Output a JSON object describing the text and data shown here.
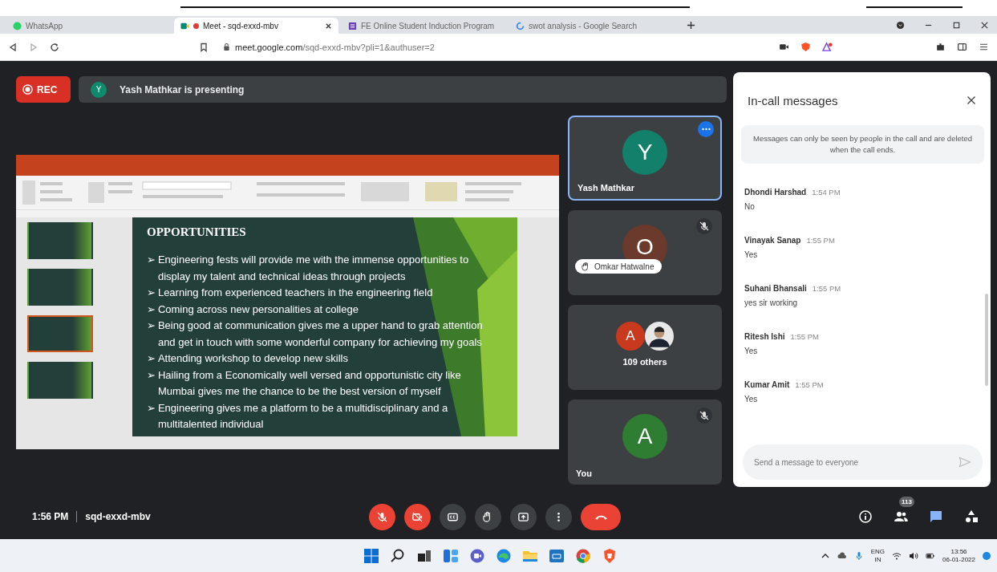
{
  "browser": {
    "tabs": [
      {
        "title": "WhatsApp",
        "kind": "whatsapp",
        "selected": false,
        "recording": false
      },
      {
        "title": "Meet - sqd-exxd-mbv",
        "kind": "meet",
        "selected": true,
        "recording": true
      },
      {
        "title": "FE Online Student Induction Program",
        "kind": "forms",
        "selected": false,
        "recording": false
      },
      {
        "title": "swot analysis - Google Search",
        "kind": "google",
        "selected": false,
        "recording": false
      }
    ],
    "url_host": "meet.google.com",
    "url_path": "/sqd-exxd-mbv?pli=1&authuser=2"
  },
  "meet": {
    "rec_label": "REC",
    "presenter": {
      "initial": "Y",
      "color": "#0f8a6c",
      "text": "Yash Mathkar is presenting"
    },
    "slide": {
      "title": "OPPORTUNITIES",
      "bullets": [
        "Engineering fests will provide me with the immense opportunities to display my talent and technical ideas through projects",
        "Learning from experienced teachers in the engineering field",
        "Coming across new personalities at college",
        "Being good at communication gives me a upper hand  to grab attention and get in touch with some wonderful company  for achieving my goals",
        "Attending workshop to develop new skills",
        " Hailing from a Economically well versed and opportunistic city like Mumbai gives me the chance to be the best version of myself",
        "Engineering gives me a platform to be a multidisciplinary and a multitalented individual"
      ],
      "bullet_mark": "➢",
      "thumbnails": [
        {
          "selected": false
        },
        {
          "selected": false
        },
        {
          "selected": true
        },
        {
          "selected": false
        }
      ]
    },
    "tiles": [
      {
        "kind": "person",
        "initial": "Y",
        "color": "#12806a",
        "name": "Yash Mathkar",
        "highlighted": true,
        "muted": false,
        "hand_raised": false
      },
      {
        "kind": "person",
        "initial": "O",
        "color": "#6b3a2c",
        "name": "Omkar Hatwalne",
        "highlighted": false,
        "muted": true,
        "hand_raised": true
      },
      {
        "kind": "group",
        "initial": "A",
        "color": "#c8391e",
        "name": "109 others",
        "highlighted": false,
        "muted": false
      },
      {
        "kind": "person",
        "initial": "A",
        "color": "#2e7d32",
        "name": "You",
        "highlighted": false,
        "muted": true,
        "hand_raised": false
      }
    ],
    "chat": {
      "title": "In-call messages",
      "notice": "Messages can only be seen by people in the call and are deleted when the call ends.",
      "messages": [
        {
          "name": "Dhondi Harshad",
          "time": "1:54 PM",
          "text": "No"
        },
        {
          "name": "Vinayak Sanap",
          "time": "1:55 PM",
          "text": "Yes"
        },
        {
          "name": "Suhani Bhansali",
          "time": "1:55 PM",
          "text": "yes sir working"
        },
        {
          "name": "Ritesh Ishi",
          "time": "1:55 PM",
          "text": "Yes"
        },
        {
          "name": "Kumar Amit",
          "time": "1:55 PM",
          "text": "Yes"
        }
      ],
      "placeholder": "Send a message to everyone"
    },
    "time": "1:56 PM",
    "code": "sqd-exxd-mbv",
    "controls": [
      {
        "kind": "mic",
        "off": true
      },
      {
        "kind": "camera",
        "off": true
      },
      {
        "kind": "captions",
        "off": false
      },
      {
        "kind": "hand",
        "off": false
      },
      {
        "kind": "present",
        "off": false
      },
      {
        "kind": "more",
        "off": false
      },
      {
        "kind": "end"
      }
    ],
    "side_buttons": [
      {
        "kind": "info",
        "selected": false
      },
      {
        "kind": "people",
        "badge": "113",
        "selected": false
      },
      {
        "kind": "chat",
        "selected": true
      },
      {
        "kind": "activities",
        "selected": false
      }
    ]
  },
  "taskbar": {
    "lang": "ENG",
    "region": "IN",
    "time": "13:56",
    "date": "06-01-2022"
  }
}
